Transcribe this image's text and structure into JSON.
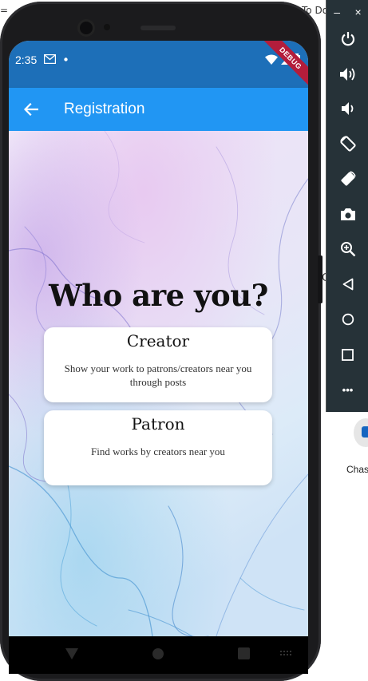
{
  "background": {
    "left_mark": "=",
    "top_right_text": "To Do",
    "side_char": "C",
    "app_label": "Chas"
  },
  "status_bar": {
    "time": "2:35",
    "debug_label": "DEBUG"
  },
  "app_bar": {
    "title": "Registration",
    "back_icon": "arrow-left-icon",
    "color": "#2196f3"
  },
  "main": {
    "heading": "Who are you?",
    "cards": [
      {
        "title": "Creator",
        "description": "Show your work to patrons/creators near you through posts"
      },
      {
        "title": "Patron",
        "description": "Find works by creators near you"
      }
    ]
  },
  "emulator_toolbar": {
    "minimize": "–",
    "close": "×",
    "buttons": [
      "power-icon",
      "volume-up-icon",
      "volume-down-icon",
      "rotate-left-icon",
      "rotate-right-icon",
      "camera-icon",
      "zoom-icon",
      "back-icon",
      "home-icon",
      "overview-icon",
      "more-icon"
    ],
    "more": "•••"
  },
  "colors": {
    "status_bar": "#1d6fb8",
    "toolbar": "#263238",
    "debug_banner": "#b31d3b"
  }
}
